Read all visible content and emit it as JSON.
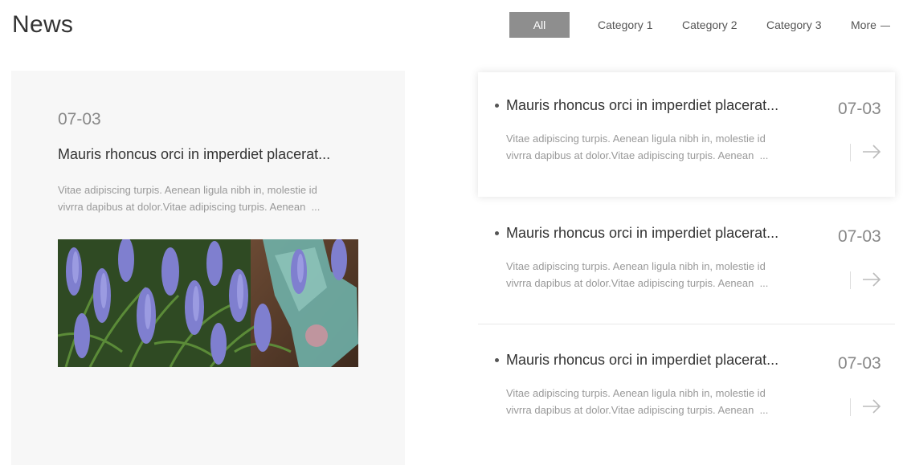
{
  "header": {
    "title": "News"
  },
  "tabs": [
    {
      "label": "All",
      "active": true
    },
    {
      "label": "Category 1",
      "active": false
    },
    {
      "label": "Category 2",
      "active": false
    },
    {
      "label": "Category 3",
      "active": false
    },
    {
      "label": "More",
      "active": false
    }
  ],
  "featured": {
    "date": "07-03",
    "title": "Mauris rhoncus orci in imperdiet placerat...",
    "excerpt_line1": "Vitae adipiscing turpis. Aenean ligula nibh in, molestie id",
    "excerpt_line2": "vivrra dapibus at dolor.Vitae adipiscing turpis. Aenean  ...",
    "image": "lavender-flowers-garden-glove-photo"
  },
  "news_items": [
    {
      "title": "Mauris rhoncus orci in imperdiet placerat...",
      "date": "07-03",
      "excerpt_line1": "Vitae adipiscing turpis. Aenean ligula nibh in, molestie id",
      "excerpt_line2": "vivrra dapibus at dolor.Vitae adipiscing turpis. Aenean  ...",
      "highlighted": true
    },
    {
      "title": "Mauris rhoncus orci in imperdiet placerat...",
      "date": "07-03",
      "excerpt_line1": "Vitae adipiscing turpis. Aenean ligula nibh in, molestie id",
      "excerpt_line2": "vivrra dapibus at dolor.Vitae adipiscing turpis. Aenean  ...",
      "highlighted": false
    },
    {
      "title": "Mauris rhoncus orci in imperdiet placerat...",
      "date": "07-03",
      "excerpt_line1": "Vitae adipiscing turpis. Aenean ligula nibh in, molestie id",
      "excerpt_line2": "vivrra dapibus at dolor.Vitae adipiscing turpis. Aenean  ...",
      "highlighted": false
    }
  ],
  "icons": {
    "arrow": "arrow-right-icon",
    "more": "dash-icon"
  },
  "colors": {
    "active_tab": "#8e8e8e",
    "featured_bg": "#f7f7f7"
  }
}
